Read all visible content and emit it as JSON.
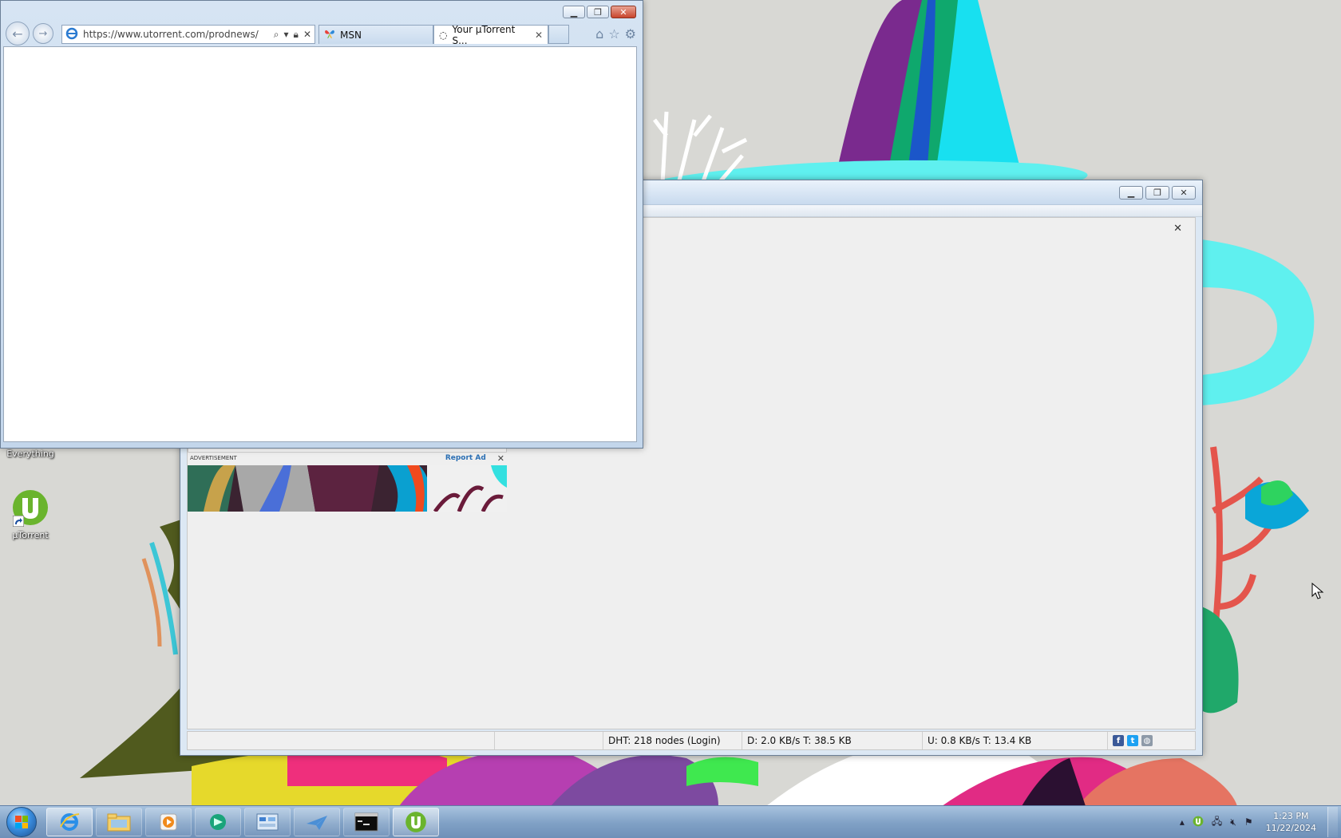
{
  "browser": {
    "address_url": "https://www.utorrent.com/prodnews/",
    "tabs": [
      {
        "label": "MSN"
      },
      {
        "label": "Your µTorrent S..."
      }
    ]
  },
  "utorrent": {
    "ad": {
      "header_label": "ADVERTISEMENT",
      "report_label": "Report Ad"
    },
    "status": {
      "dht": "DHT: 218 nodes (Login)",
      "download": "D: 2.0 KB/s T: 38.5 KB",
      "upload": "U: 0.8 KB/s T: 13.4 KB"
    }
  },
  "desktop": {
    "icons": [
      {
        "label": "Everything"
      },
      {
        "label": "µTorrent"
      }
    ]
  },
  "taskbar": {
    "clock_time": "1:23 PM",
    "clock_date": "11/22/2024"
  },
  "colors": {
    "utorrent_green": "#6ab42d",
    "accent_blue": "#2b6fb4"
  }
}
